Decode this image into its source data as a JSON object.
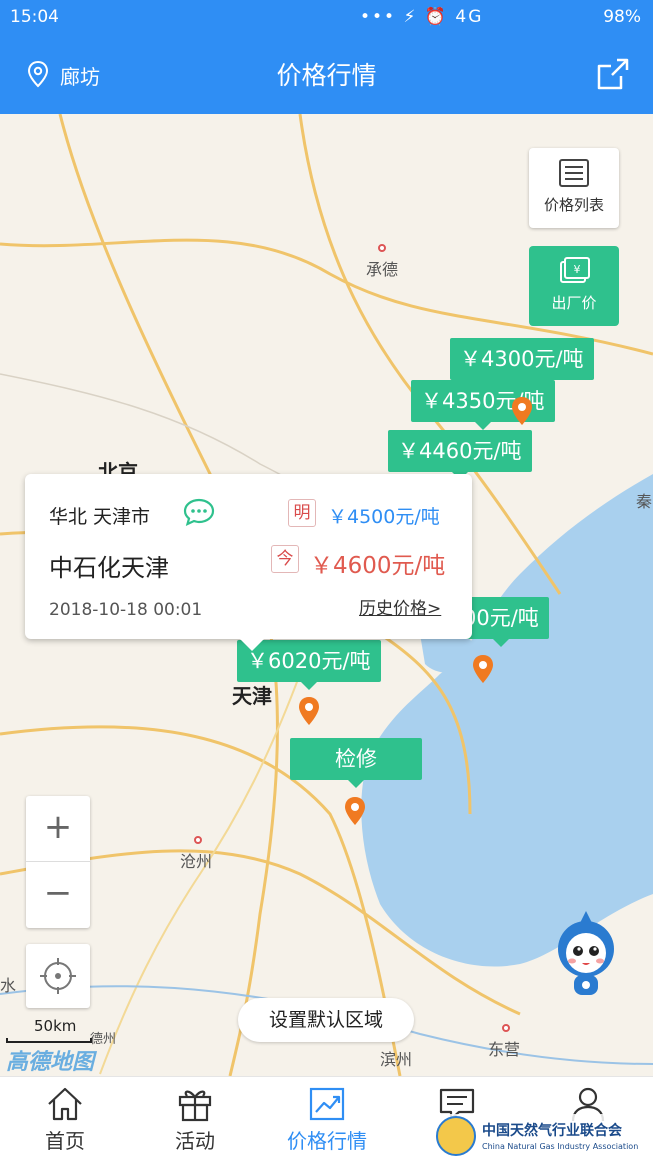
{
  "status_bar": {
    "time": "15:04",
    "icons": "••• ⚡ ⏰ 4G",
    "network": "4G",
    "battery": "98%"
  },
  "header": {
    "location": "廊坊",
    "title": "价格行情",
    "share_icon": "share-icon",
    "location_icon": "location-pin-icon"
  },
  "map": {
    "labels": [
      "承德",
      "北京",
      "天津",
      "沧州",
      "滨州",
      "东营",
      "秦",
      "水",
      "德州"
    ],
    "buttons": [
      {
        "label": "价格列表",
        "icon": "list-icon"
      },
      {
        "label": "出厂价",
        "icon": "factory-price-icon"
      }
    ],
    "price_tags": [
      "￥4300元/吨",
      "￥4350元/吨",
      "￥4460元/吨",
      "00元/吨",
      "￥6020元/吨",
      "检修"
    ],
    "popup": {
      "region": "华北 天津市",
      "tomorrow_tag": "明",
      "tomorrow_price": "￥4500元/吨",
      "company": "中石化天津",
      "today_tag": "今",
      "today_price": "￥4600元/吨",
      "date": "2018-10-18 00:01",
      "history_link": "历史价格>"
    },
    "zoom_in": "+",
    "zoom_out": "−",
    "scale": "50km",
    "logo": "高德地图",
    "default_area_button": "设置默认区域"
  },
  "nav": [
    {
      "label": "首页",
      "icon": "home-icon",
      "active": false
    },
    {
      "label": "活动",
      "icon": "gift-icon",
      "active": false
    },
    {
      "label": "价格行情",
      "icon": "trend-chart-icon",
      "active": true
    },
    {
      "label": "",
      "icon": "message-icon",
      "active": false
    },
    {
      "label": "",
      "icon": "user-icon",
      "active": false
    }
  ],
  "watermark": {
    "cn": "中国天然气行业联合会",
    "en": "China Natural Gas Industry Association"
  },
  "colors": {
    "primary": "#2f8ef4",
    "green": "#2fc18d",
    "sea": "#a9d0ee",
    "pin": "#f07a21",
    "today_price": "#e05a4f"
  }
}
